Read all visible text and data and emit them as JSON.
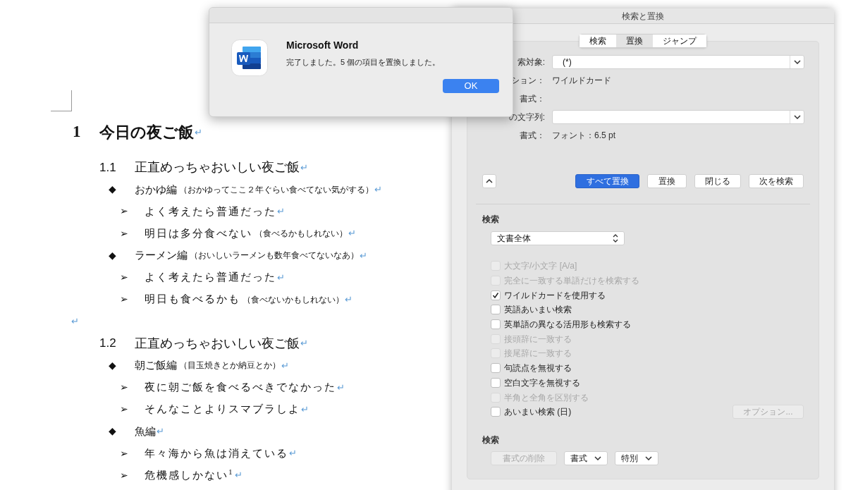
{
  "document": {
    "paragraphs": [
      {
        "kind": "heading1",
        "number": "1",
        "text": "今日の夜ご飯",
        "mark": "↵"
      },
      {
        "kind": "heading2",
        "number": "1.1",
        "text": "正直めっちゃおいしい夜ご飯",
        "mark": "↵"
      },
      {
        "kind": "bullet",
        "symbol": "◆",
        "text": "おかゆ編",
        "note": "（おかゆってここ２年ぐらい食べてない気がする）",
        "mark": "↵"
      },
      {
        "kind": "arrow",
        "symbol": "➢",
        "text": "よく考えたら普通だった",
        "mark": "↵"
      },
      {
        "kind": "arrow",
        "symbol": "➢",
        "text": "明日は多分食べない",
        "note": "（食べるかもしれない）",
        "mark": "↵"
      },
      {
        "kind": "bullet",
        "symbol": "◆",
        "text": "ラーメン編",
        "note": "（おいしいラーメンも数年食べてないなあ）",
        "mark": "↵"
      },
      {
        "kind": "arrow",
        "symbol": "➢",
        "text": "よく考えたら普通だった",
        "mark": "↵"
      },
      {
        "kind": "arrow",
        "symbol": "➢",
        "text": "明日も食べるかも",
        "note": "（食べないかもしれない）",
        "mark": "↵"
      },
      {
        "kind": "empty",
        "mark": "↵"
      },
      {
        "kind": "heading2",
        "number": "1.2",
        "text": "正直めっちゃおいしい夜ご飯",
        "mark": "↵"
      },
      {
        "kind": "bullet",
        "symbol": "◆",
        "text": "朝ご飯編",
        "note": "（目玉焼きとか納豆とか）",
        "mark": "↵"
      },
      {
        "kind": "arrow",
        "symbol": "➢",
        "text": "夜に朝ご飯を食べるべきでなかった",
        "mark": "↵"
      },
      {
        "kind": "arrow",
        "symbol": "➢",
        "text": "そんなことよりスマブラしよ",
        "mark": "↵"
      },
      {
        "kind": "bullet",
        "symbol": "◆",
        "text": "魚編",
        "mark": "↵"
      },
      {
        "kind": "arrow",
        "symbol": "➢",
        "text": "年々海から魚は消えている",
        "mark": "↵"
      },
      {
        "kind": "arrow",
        "symbol": "➢",
        "text": "危機感しかない$^{1}$",
        "mark": "↵"
      }
    ]
  },
  "replace_dialog": {
    "title": "検索と置換",
    "tabs": [
      {
        "label": "検索",
        "selected": false
      },
      {
        "label": "置換",
        "selected": true
      },
      {
        "label": "ジャンプ",
        "selected": false
      }
    ],
    "fields": [
      {
        "kind": "combo",
        "label": "索対象:",
        "value": "(*)"
      },
      {
        "kind": "text",
        "label": "ション：",
        "value": "ワイルドカード"
      },
      {
        "kind": "text",
        "label": "書式："
      },
      {
        "kind": "combo",
        "label": "の文字列:"
      },
      {
        "kind": "text",
        "label": "書式：",
        "value": "フォント：6.5 pt"
      }
    ],
    "buttons": [
      {
        "label": "すべて置換",
        "default": true
      },
      {
        "label": "置換",
        "default": false
      },
      {
        "label": "閉じる",
        "default": false
      },
      {
        "label": "次を検索",
        "default": false
      }
    ],
    "search_heading": "検索",
    "scope": "文書全体",
    "checkboxes": [
      {
        "label": "大文字/小文字 [A/a]",
        "checked": false,
        "disabled": true
      },
      {
        "label": "完全に一致する単語だけを検索する",
        "checked": false,
        "disabled": true
      },
      {
        "label": "ワイルドカードを使用する",
        "checked": true,
        "disabled": false
      },
      {
        "label": "英語あいまい検索",
        "checked": false,
        "disabled": false
      },
      {
        "label": "英単語の異なる活用形も検索する",
        "checked": false,
        "disabled": false
      },
      {
        "label": "接頭辞に一致する",
        "checked": false,
        "disabled": true
      },
      {
        "label": "接尾辞に一致する",
        "checked": false,
        "disabled": true
      },
      {
        "label": "句読点を無視する",
        "checked": false,
        "disabled": false
      },
      {
        "label": "空白文字を無視する",
        "checked": false,
        "disabled": false
      },
      {
        "label": "半角と全角を区別する",
        "checked": false,
        "disabled": true
      },
      {
        "label": "あいまい検索 (日)",
        "checked": false,
        "disabled": false
      }
    ],
    "options_button": {
      "label": "オプション...",
      "disabled": true
    },
    "format_heading": "検索",
    "format_buttons": [
      {
        "label": "書式の削除",
        "disabled": true,
        "dropdown": false
      },
      {
        "label": "書式",
        "disabled": false,
        "dropdown": true
      },
      {
        "label": "特別",
        "disabled": false,
        "dropdown": true
      }
    ]
  },
  "alert": {
    "title": "Microsoft Word",
    "message": "完了しました。5 個の項目を置換しました。",
    "button": "OK"
  }
}
